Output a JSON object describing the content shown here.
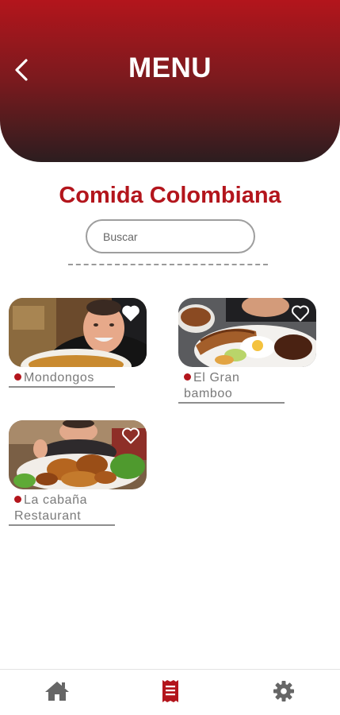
{
  "header": {
    "title": "MENU"
  },
  "section_title": "Comida Colombiana",
  "search": {
    "placeholder": "Buscar"
  },
  "restaurants": [
    {
      "name": "Mondongos",
      "favorite": true
    },
    {
      "name": "El Gran bamboo",
      "favorite": false
    },
    {
      "name": "La cabaña Restaurant",
      "favorite": false
    }
  ],
  "bottom_nav": {
    "items": [
      {
        "icon": "home-icon",
        "active": false
      },
      {
        "icon": "menu-receipt-icon",
        "active": true
      },
      {
        "icon": "gear-icon",
        "active": false
      }
    ]
  },
  "colors": {
    "accent": "#b3151c",
    "header_dark": "#2c1d1f",
    "inactive_icon": "#666666"
  }
}
